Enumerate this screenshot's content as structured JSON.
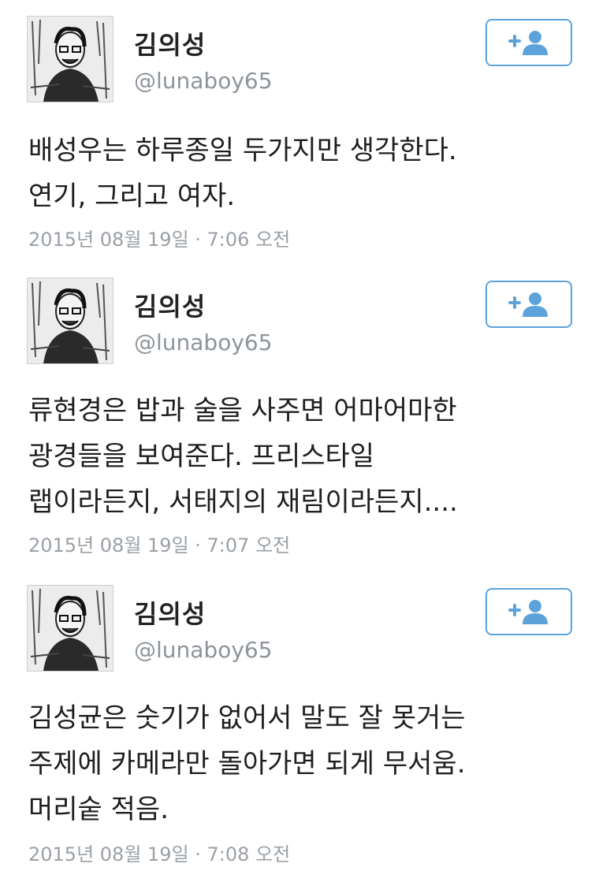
{
  "tweets": [
    {
      "display_name": "김의성",
      "handle": "@lunaboy65",
      "text_lines": [
        "배성우는 하루종일 두가지만 생각한다.",
        "연기, 그리고 여자."
      ],
      "timestamp": "2015년 08월 19일 · 7:06 오전"
    },
    {
      "display_name": "김의성",
      "handle": "@lunaboy65",
      "text_lines": [
        "류현경은 밥과 술을 사주면 어마어마한",
        "광경들을 보여준다. 프리스타일",
        "랩이라든지, 서태지의 재림이라든지...."
      ],
      "timestamp": "2015년 08월 19일 · 7:07 오전"
    },
    {
      "display_name": "김의성",
      "handle": "@lunaboy65",
      "text_lines": [
        "김성균은 숫기가 없어서 말도 잘 못거는",
        "주제에 카메라만 돌아가면 되게 무서움.",
        "머리숱 적음."
      ],
      "timestamp": "2015년 08월 19일 · 7:08 오전"
    }
  ],
  "follow_button": {
    "icon": "add-user-icon",
    "color": "#5ca3dc"
  }
}
